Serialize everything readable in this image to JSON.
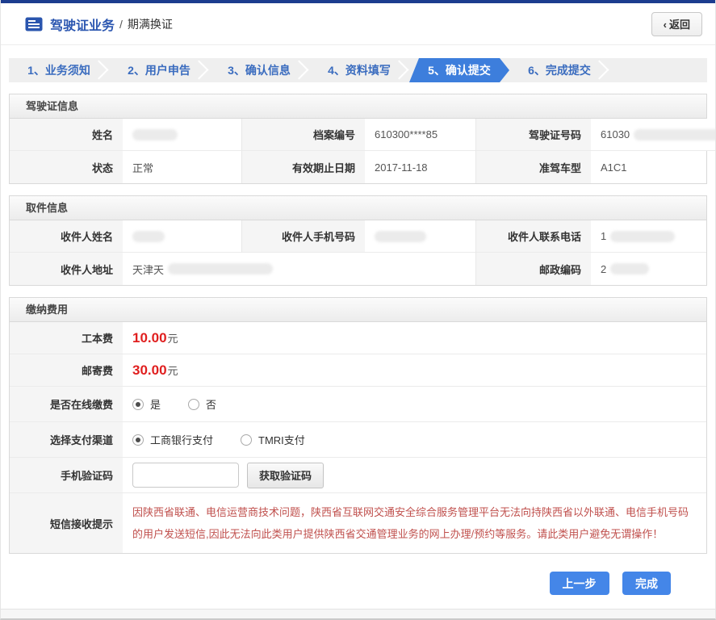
{
  "header": {
    "title": "驾驶证业务",
    "separator": "/",
    "subtitle": "期满换证",
    "back_chevron": "‹",
    "back_label": "返回"
  },
  "steps": {
    "items": [
      {
        "label": "1、业务须知"
      },
      {
        "label": "2、用户申告"
      },
      {
        "label": "3、确认信息"
      },
      {
        "label": "4、资料填写"
      },
      {
        "label": "5、确认提交"
      },
      {
        "label": "6、完成提交"
      }
    ],
    "active_step": "5、确认提交"
  },
  "license_info": {
    "section_title": "驾驶证信息",
    "name_label": "姓名",
    "name_value_redacted": "",
    "file_number_label": "档案编号",
    "file_number_value": "610300****85",
    "license_number_label": "驾驶证号码",
    "license_number_visible_prefix": "61030",
    "status_label": "状态",
    "status_value": "正常",
    "valid_until_label": "有效期止日期",
    "valid_until_value": "2017-11-18",
    "permitted_vehicle_label": "准驾车型",
    "permitted_vehicle_value": "A1C1"
  },
  "pickup_info": {
    "section_title": "取件信息",
    "recipient_name_label": "收件人姓名",
    "recipient_mobile_label": "收件人手机号码",
    "recipient_phone_label": "收件人联系电话",
    "recipient_phone_visible_prefix": "1",
    "recipient_address_label": "收件人地址",
    "recipient_address_visible_prefix": "天津天",
    "postal_code_label": "邮政编码",
    "postal_code_visible_prefix": "2"
  },
  "payment": {
    "section_title": "缴纳费用",
    "production_fee_label": "工本费",
    "production_fee_value": "10.00",
    "mailing_fee_label": "邮寄费",
    "mailing_fee_value": "30.00",
    "currency_unit": "元",
    "pay_online_label": "是否在线缴费",
    "pay_online_yes": "是",
    "pay_online_no": "否",
    "pay_online_selected": "是",
    "channel_label": "选择支付渠道",
    "channel_icbc": "工商银行支付",
    "channel_tmri": "TMRI支付",
    "channel_selected": "工商银行支付",
    "sms_code_label": "手机验证码",
    "sms_code_value": "",
    "get_code_button": "获取验证码",
    "sms_tip_label": "短信接收提示",
    "sms_tip_text": "因陕西省联通、电信运营商技术问题，陕西省互联网交通安全综合服务管理平台无法向持陕西省以外联通、电信手机号码的用户发送短信,因此无法向此类用户提供陕西省交通管理业务的网上办理/预约等服务。请此类用户避免无谓操作！"
  },
  "footer": {
    "prev_button": "上一步",
    "finish_button": "完成"
  },
  "colors": {
    "top_bar_navy": "#1c3d8f",
    "title_blue": "#2b56b0",
    "step_text_blue": "#3a6cbf",
    "step_active_blue": "#3d7edc",
    "button_blue": "#4486e8",
    "fee_red": "#e01f1f",
    "tip_red": "#c0504d"
  }
}
